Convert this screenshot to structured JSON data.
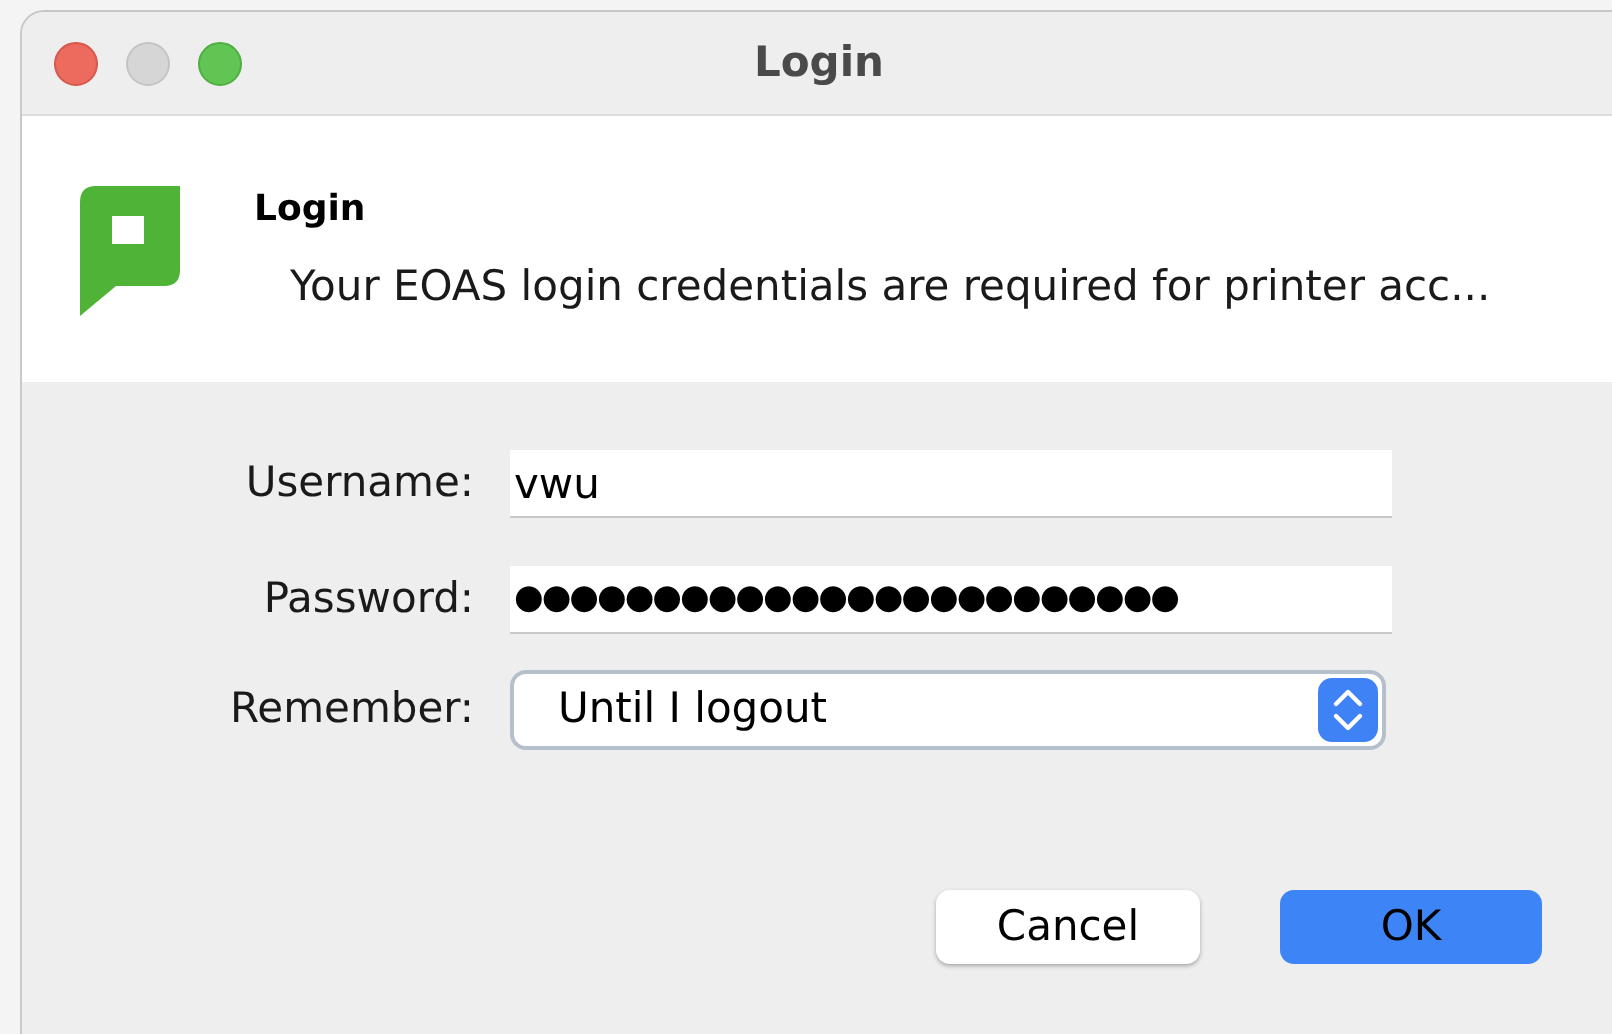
{
  "window": {
    "title": "Login"
  },
  "header": {
    "title": "Login",
    "message": "Your EOAS login credentials are required for printer acc..."
  },
  "form": {
    "username": {
      "label": "Username:",
      "value": "vwu"
    },
    "password": {
      "label": "Password:",
      "value": "●●●●●●●●●●●●●●●●●●●●●●●●"
    },
    "remember": {
      "label": "Remember:",
      "value": "Until I logout"
    }
  },
  "buttons": [
    {
      "label": "Cancel",
      "kind": "secondary"
    },
    {
      "label": "OK",
      "kind": "primary"
    }
  ]
}
